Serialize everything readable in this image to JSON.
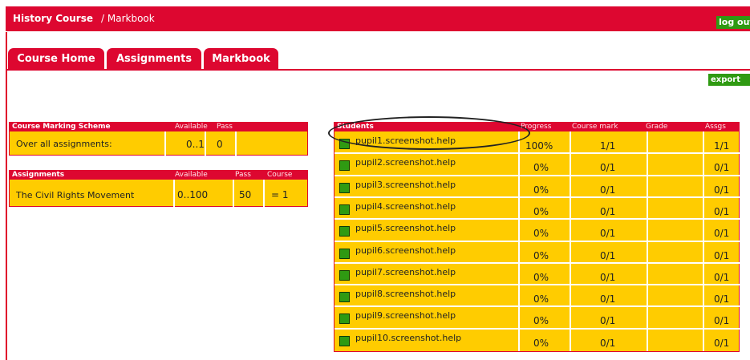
{
  "header": {
    "course_title": "History Course",
    "breadcrumb": "/ Markbook",
    "logout_label": "log out"
  },
  "tabs": [
    {
      "label": "Course Home"
    },
    {
      "label": "Assignments"
    },
    {
      "label": "Markbook"
    }
  ],
  "export_label": "export",
  "marking_scheme": {
    "title": "Course Marking Scheme",
    "col_available": "Available",
    "col_pass": "Pass",
    "row_label": "Over all assignments:",
    "available": "0..1",
    "pass": "0"
  },
  "assignments": {
    "title": "Assignments",
    "col_available": "Available",
    "col_pass": "Pass",
    "col_course": "Course",
    "rows": [
      {
        "name": "The Civil Rights Movement",
        "available": "0..100",
        "pass": "50",
        "course": "= 1"
      }
    ]
  },
  "students": {
    "title": "Students",
    "col_progress": "Progress",
    "col_course_mark": "Course mark",
    "col_grade": "Grade",
    "col_assgs": "Assgs",
    "rows": [
      {
        "name": "pupil1.screenshot.help",
        "progress": "100%",
        "mark": "1/1",
        "grade": "",
        "assgs": "1/1"
      },
      {
        "name": "pupil2.screenshot.help",
        "progress": "0%",
        "mark": "0/1",
        "grade": "",
        "assgs": "0/1"
      },
      {
        "name": "pupil3.screenshot.help",
        "progress": "0%",
        "mark": "0/1",
        "grade": "",
        "assgs": "0/1"
      },
      {
        "name": "pupil4.screenshot.help",
        "progress": "0%",
        "mark": "0/1",
        "grade": "",
        "assgs": "0/1"
      },
      {
        "name": "pupil5.screenshot.help",
        "progress": "0%",
        "mark": "0/1",
        "grade": "",
        "assgs": "0/1"
      },
      {
        "name": "pupil6.screenshot.help",
        "progress": "0%",
        "mark": "0/1",
        "grade": "",
        "assgs": "0/1"
      },
      {
        "name": "pupil7.screenshot.help",
        "progress": "0%",
        "mark": "0/1",
        "grade": "",
        "assgs": "0/1"
      },
      {
        "name": "pupil8.screenshot.help",
        "progress": "0%",
        "mark": "0/1",
        "grade": "",
        "assgs": "0/1"
      },
      {
        "name": "pupil9.screenshot.help",
        "progress": "0%",
        "mark": "0/1",
        "grade": "",
        "assgs": "0/1"
      },
      {
        "name": "pupil10.screenshot.help",
        "progress": "0%",
        "mark": "0/1",
        "grade": "",
        "assgs": "0/1"
      }
    ]
  },
  "colors": {
    "brand_red": "#dd0730",
    "cell_yellow": "#ffcc00",
    "status_green": "#2f9a12"
  },
  "icons": {
    "student_status": "green-square-icon"
  }
}
